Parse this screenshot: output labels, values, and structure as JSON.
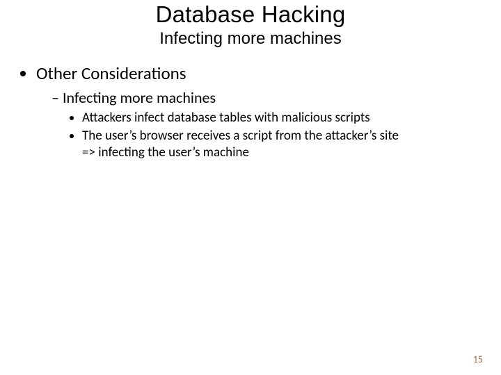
{
  "title": "Database Hacking",
  "subtitle": "Infecting more machines",
  "bullet1": "Other Considerations",
  "sub1": "Infecting more machines",
  "detail1": "Attackers infect database tables with malicious scripts",
  "detail2a": "The user’s browser receives a script from the attacker’s site",
  "detail2b": "=> infecting the user’s machine",
  "page_number": "15"
}
